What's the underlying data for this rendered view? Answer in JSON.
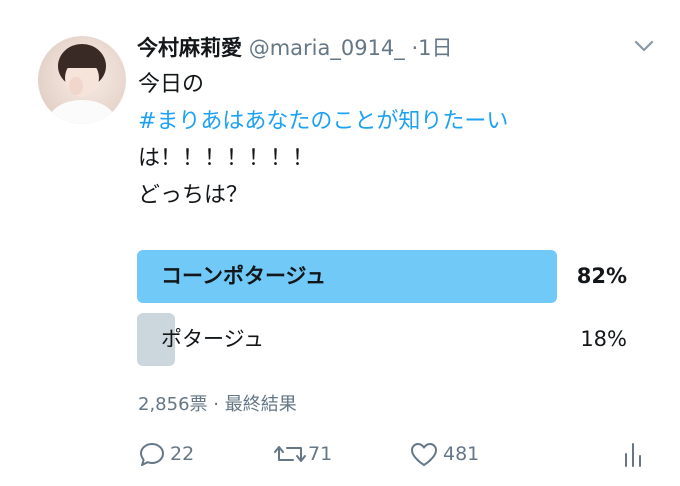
{
  "tweet": {
    "author_name": "今村麻莉愛",
    "handle": "@maria_0914_",
    "separator": "·",
    "time": "1日",
    "text_line1": "今日の",
    "hashtag": "#まりあはあなたのことが知りたーい",
    "text_line3": "は！！！！！！！",
    "text_line4": "どっちは？"
  },
  "poll": {
    "options": [
      {
        "label": "コーンポタージュ",
        "percent_label": "82%",
        "percent": 82,
        "winner": true
      },
      {
        "label": "ポタージュ",
        "percent_label": "18%",
        "percent": 18,
        "winner": false
      }
    ],
    "meta": "2,856票 · 最終結果"
  },
  "actions": {
    "replies": "22",
    "retweets": "71",
    "likes": "481"
  },
  "colors": {
    "accent": "#1da1f2",
    "winner_bar": "#71c9f8",
    "loser_bar": "#ccd6dd",
    "muted": "#657786"
  },
  "icons": [
    "reply-icon",
    "retweet-icon",
    "like-icon",
    "analytics-icon",
    "chevron-down-icon"
  ]
}
